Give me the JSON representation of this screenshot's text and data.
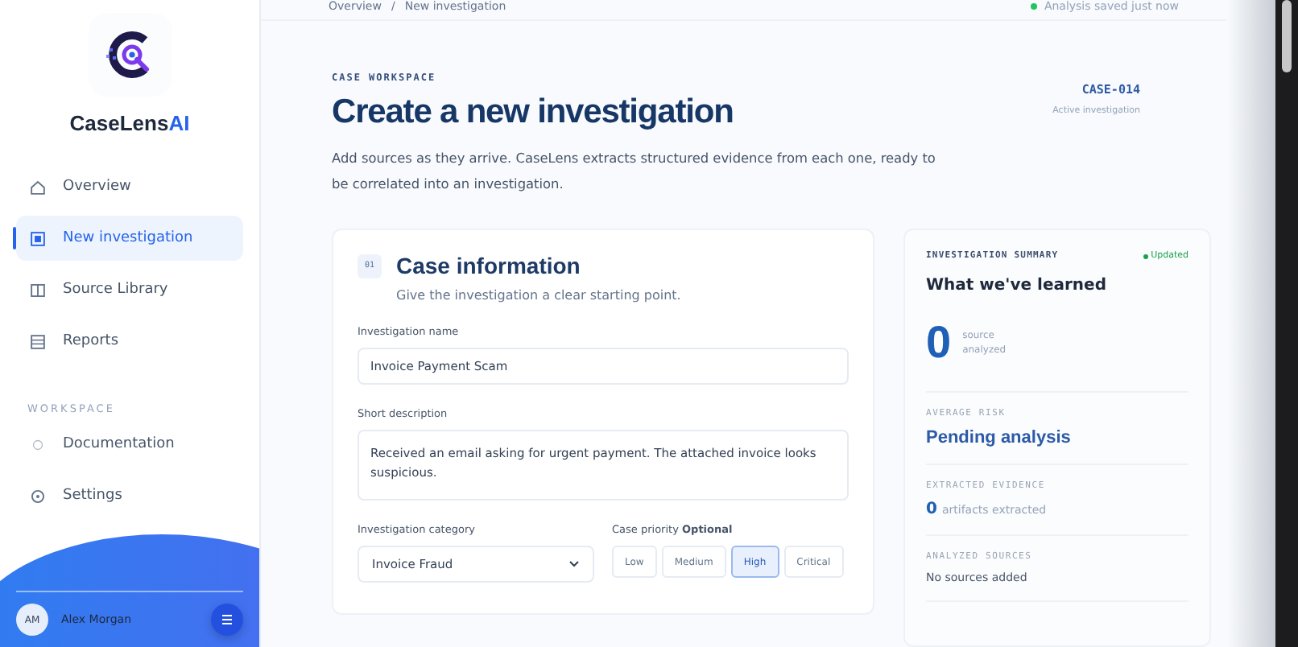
{
  "sidebar": {
    "brand": {
      "name": "CaseLens",
      "suffix": "AI"
    },
    "nav": [
      {
        "label": "Overview",
        "selected": false
      },
      {
        "label": "New investigation",
        "selected": true
      },
      {
        "label": "Source Library",
        "selected": false
      },
      {
        "label": "Reports",
        "selected": false
      }
    ],
    "section_title": "WORKSPACE",
    "workspace": [
      {
        "label": "Documentation",
        "selected": false
      },
      {
        "label": "Settings",
        "selected": false
      }
    ],
    "user": {
      "initials": "AM",
      "name": "Alex Morgan"
    }
  },
  "topbar": {
    "breadcrumb": [
      "Overview",
      "New investigation"
    ],
    "separator": "/",
    "status": "Analysis saved just now"
  },
  "header": {
    "eyebrow": "CASE WORKSPACE",
    "title": "Create a new investigation",
    "description": "Add sources as they arrive. CaseLens extracts structured evidence from each one, ready to be correlated into an investigation.",
    "case_id": "CASE-014",
    "case_status": "Active investigation"
  },
  "case_info": {
    "step": "01",
    "title": "Case information",
    "subtitle": "Give the investigation a clear starting point.",
    "name_label": "Investigation name",
    "name_value": "Invoice Payment Scam",
    "description_label": "Short description",
    "description_value": "Received an email asking for urgent payment. The attached invoice looks suspicious.",
    "category_label": "Investigation category",
    "category_value": "Invoice Fraud",
    "priority_label": "Case priority",
    "priority_hint": "Optional",
    "priorities": [
      {
        "label": "Low",
        "selected": false
      },
      {
        "label": "Medium",
        "selected": false
      },
      {
        "label": "High",
        "selected": true
      },
      {
        "label": "Critical",
        "selected": false
      }
    ]
  },
  "summary": {
    "eyebrow": "INVESTIGATION SUMMARY",
    "badge": "Updated",
    "title": "What we've learned",
    "count": "0",
    "count_label": "source analyzed",
    "risk_label": "AVERAGE RISK",
    "risk_value": "Pending analysis",
    "evidence_label": "EXTRACTED EVIDENCE",
    "evidence_count": "0",
    "evidence_text": "artifacts extracted",
    "sources_label": "ANALYZED SOURCES",
    "sources_value": "No sources added"
  }
}
